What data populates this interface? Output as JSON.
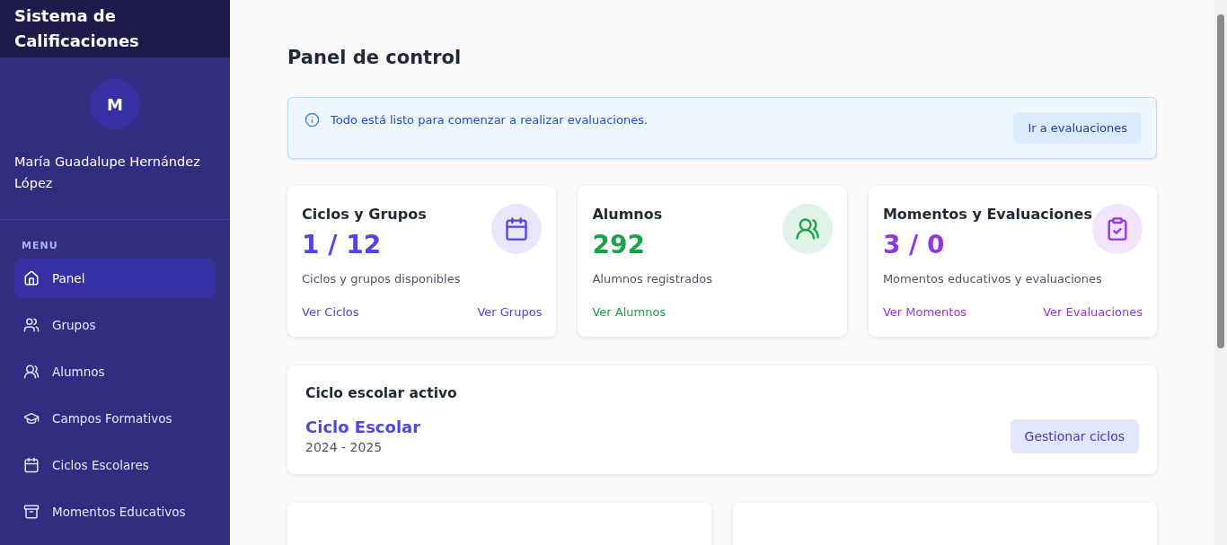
{
  "sidebar": {
    "title": "Sistema de Calificaciones",
    "avatar_initial": "M",
    "user_name": "María Guadalupe Hernández López",
    "menu_heading": "MENU",
    "items": [
      {
        "label": "Panel",
        "selected": true
      },
      {
        "label": "Grupos",
        "selected": false
      },
      {
        "label": "Alumnos",
        "selected": false
      },
      {
        "label": "Campos Formativos",
        "selected": false
      },
      {
        "label": "Ciclos Escolares",
        "selected": false
      },
      {
        "label": "Momentos Educativos",
        "selected": false
      }
    ]
  },
  "page_title": "Panel de control",
  "alert": {
    "message": "Todo está listo para comenzar a realizar evaluaciones.",
    "button": "Ir a evaluaciones"
  },
  "stats": [
    {
      "title": "Ciclos y Grupos",
      "value": "1 / 12",
      "caption": "Ciclos y grupos disponibles",
      "color": "#4f46e5",
      "links": [
        "Ver Ciclos",
        "Ver Grupos"
      ]
    },
    {
      "title": "Alumnos",
      "value": "292",
      "caption": "Alumnos registrados",
      "color": "#16a34a",
      "links": [
        "Ver Alumnos"
      ]
    },
    {
      "title": "Momentos y Evaluaciones",
      "value": "3 / 0",
      "caption": "Momentos educativos y evaluaciones",
      "color": "#9333ea",
      "links": [
        "Ver Momentos",
        "Ver Evaluaciones"
      ]
    }
  ],
  "active_cycle": {
    "heading": "Ciclo escolar activo",
    "name": "Ciclo Escolar",
    "years": "2024 - 2025",
    "button": "Gestionar ciclos"
  }
}
